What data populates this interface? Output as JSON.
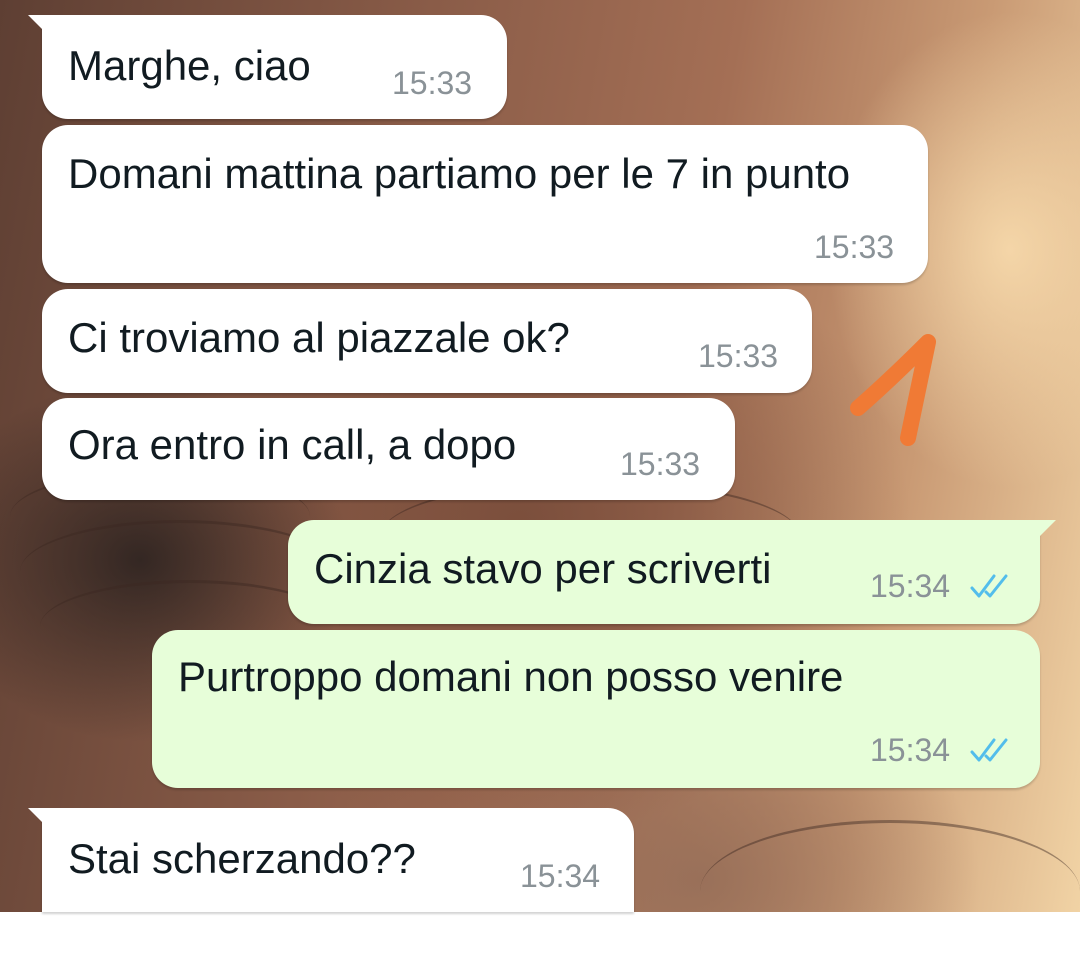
{
  "colors": {
    "incoming_bubble": "#ffffff",
    "outgoing_bubble": "#e7fed9",
    "text": "#111b21",
    "timestamp": "#8a9297",
    "read_ticks": "#53bdeb",
    "annotation": "#f07a35"
  },
  "annotation_mark": "1",
  "messages": [
    {
      "direction": "incoming",
      "text": "Marghe, ciao",
      "time": "15:33"
    },
    {
      "direction": "incoming",
      "text": "Domani mattina partiamo per le 7 in punto",
      "time": "15:33"
    },
    {
      "direction": "incoming",
      "text": "Ci troviamo al piazzale ok?",
      "time": "15:33"
    },
    {
      "direction": "incoming",
      "text": "Ora entro in call, a dopo",
      "time": "15:33"
    },
    {
      "direction": "outgoing",
      "text": "Cinzia stavo per scriverti",
      "time": "15:34",
      "status_icon": "double-check-read-icon"
    },
    {
      "direction": "outgoing",
      "text": "Purtroppo domani non posso venire",
      "time": "15:34",
      "status_icon": "double-check-read-icon"
    },
    {
      "direction": "incoming",
      "text": "Stai scherzando??",
      "time": "15:34"
    }
  ]
}
